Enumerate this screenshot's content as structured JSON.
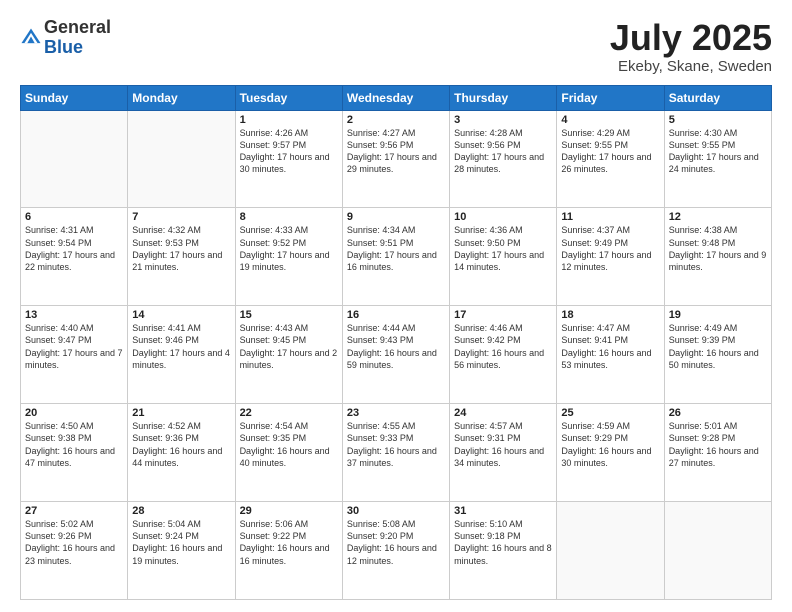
{
  "logo": {
    "general": "General",
    "blue": "Blue"
  },
  "header": {
    "month": "July 2025",
    "location": "Ekeby, Skane, Sweden"
  },
  "weekdays": [
    "Sunday",
    "Monday",
    "Tuesday",
    "Wednesday",
    "Thursday",
    "Friday",
    "Saturday"
  ],
  "weeks": [
    [
      {
        "day": "",
        "info": ""
      },
      {
        "day": "",
        "info": ""
      },
      {
        "day": "1",
        "info": "Sunrise: 4:26 AM\nSunset: 9:57 PM\nDaylight: 17 hours and 30 minutes."
      },
      {
        "day": "2",
        "info": "Sunrise: 4:27 AM\nSunset: 9:56 PM\nDaylight: 17 hours and 29 minutes."
      },
      {
        "day": "3",
        "info": "Sunrise: 4:28 AM\nSunset: 9:56 PM\nDaylight: 17 hours and 28 minutes."
      },
      {
        "day": "4",
        "info": "Sunrise: 4:29 AM\nSunset: 9:55 PM\nDaylight: 17 hours and 26 minutes."
      },
      {
        "day": "5",
        "info": "Sunrise: 4:30 AM\nSunset: 9:55 PM\nDaylight: 17 hours and 24 minutes."
      }
    ],
    [
      {
        "day": "6",
        "info": "Sunrise: 4:31 AM\nSunset: 9:54 PM\nDaylight: 17 hours and 22 minutes."
      },
      {
        "day": "7",
        "info": "Sunrise: 4:32 AM\nSunset: 9:53 PM\nDaylight: 17 hours and 21 minutes."
      },
      {
        "day": "8",
        "info": "Sunrise: 4:33 AM\nSunset: 9:52 PM\nDaylight: 17 hours and 19 minutes."
      },
      {
        "day": "9",
        "info": "Sunrise: 4:34 AM\nSunset: 9:51 PM\nDaylight: 17 hours and 16 minutes."
      },
      {
        "day": "10",
        "info": "Sunrise: 4:36 AM\nSunset: 9:50 PM\nDaylight: 17 hours and 14 minutes."
      },
      {
        "day": "11",
        "info": "Sunrise: 4:37 AM\nSunset: 9:49 PM\nDaylight: 17 hours and 12 minutes."
      },
      {
        "day": "12",
        "info": "Sunrise: 4:38 AM\nSunset: 9:48 PM\nDaylight: 17 hours and 9 minutes."
      }
    ],
    [
      {
        "day": "13",
        "info": "Sunrise: 4:40 AM\nSunset: 9:47 PM\nDaylight: 17 hours and 7 minutes."
      },
      {
        "day": "14",
        "info": "Sunrise: 4:41 AM\nSunset: 9:46 PM\nDaylight: 17 hours and 4 minutes."
      },
      {
        "day": "15",
        "info": "Sunrise: 4:43 AM\nSunset: 9:45 PM\nDaylight: 17 hours and 2 minutes."
      },
      {
        "day": "16",
        "info": "Sunrise: 4:44 AM\nSunset: 9:43 PM\nDaylight: 16 hours and 59 minutes."
      },
      {
        "day": "17",
        "info": "Sunrise: 4:46 AM\nSunset: 9:42 PM\nDaylight: 16 hours and 56 minutes."
      },
      {
        "day": "18",
        "info": "Sunrise: 4:47 AM\nSunset: 9:41 PM\nDaylight: 16 hours and 53 minutes."
      },
      {
        "day": "19",
        "info": "Sunrise: 4:49 AM\nSunset: 9:39 PM\nDaylight: 16 hours and 50 minutes."
      }
    ],
    [
      {
        "day": "20",
        "info": "Sunrise: 4:50 AM\nSunset: 9:38 PM\nDaylight: 16 hours and 47 minutes."
      },
      {
        "day": "21",
        "info": "Sunrise: 4:52 AM\nSunset: 9:36 PM\nDaylight: 16 hours and 44 minutes."
      },
      {
        "day": "22",
        "info": "Sunrise: 4:54 AM\nSunset: 9:35 PM\nDaylight: 16 hours and 40 minutes."
      },
      {
        "day": "23",
        "info": "Sunrise: 4:55 AM\nSunset: 9:33 PM\nDaylight: 16 hours and 37 minutes."
      },
      {
        "day": "24",
        "info": "Sunrise: 4:57 AM\nSunset: 9:31 PM\nDaylight: 16 hours and 34 minutes."
      },
      {
        "day": "25",
        "info": "Sunrise: 4:59 AM\nSunset: 9:29 PM\nDaylight: 16 hours and 30 minutes."
      },
      {
        "day": "26",
        "info": "Sunrise: 5:01 AM\nSunset: 9:28 PM\nDaylight: 16 hours and 27 minutes."
      }
    ],
    [
      {
        "day": "27",
        "info": "Sunrise: 5:02 AM\nSunset: 9:26 PM\nDaylight: 16 hours and 23 minutes."
      },
      {
        "day": "28",
        "info": "Sunrise: 5:04 AM\nSunset: 9:24 PM\nDaylight: 16 hours and 19 minutes."
      },
      {
        "day": "29",
        "info": "Sunrise: 5:06 AM\nSunset: 9:22 PM\nDaylight: 16 hours and 16 minutes."
      },
      {
        "day": "30",
        "info": "Sunrise: 5:08 AM\nSunset: 9:20 PM\nDaylight: 16 hours and 12 minutes."
      },
      {
        "day": "31",
        "info": "Sunrise: 5:10 AM\nSunset: 9:18 PM\nDaylight: 16 hours and 8 minutes."
      },
      {
        "day": "",
        "info": ""
      },
      {
        "day": "",
        "info": ""
      }
    ]
  ]
}
